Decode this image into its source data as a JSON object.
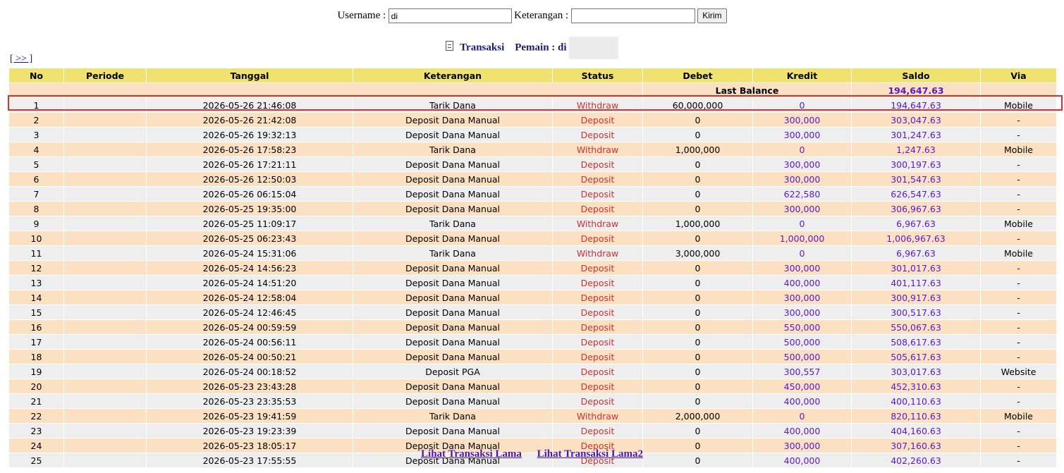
{
  "form": {
    "username_label": "Username :",
    "username_value": "di",
    "keterangan_label": "Keterangan :",
    "keterangan_value": "",
    "submit_label": "Kirim"
  },
  "title": {
    "transaksi": "Transaksi",
    "pemain_label": "Pemain : di"
  },
  "pager": {
    "next_label": "[ >> ]"
  },
  "table": {
    "headers": [
      "No",
      "Periode",
      "Tanggal",
      "Keterangan",
      "Status",
      "Debet",
      "Kredit",
      "Saldo",
      "Via"
    ],
    "last_balance_label": "Last Balance",
    "last_balance_value": "194,647.63",
    "rows": [
      [
        "1",
        "",
        "2026-05-26 21:46:08",
        "Tarik Dana",
        "Withdraw",
        "60,000,000",
        "0",
        "194,647.63",
        "Mobile"
      ],
      [
        "2",
        "",
        "2026-05-26 21:42:08",
        "Deposit Dana Manual",
        "Deposit",
        "0",
        "300,000",
        "303,047.63",
        "-"
      ],
      [
        "3",
        "",
        "2026-05-26 19:32:13",
        "Deposit Dana Manual",
        "Deposit",
        "0",
        "300,000",
        "301,247.63",
        "-"
      ],
      [
        "4",
        "",
        "2026-05-26 17:58:23",
        "Tarik Dana",
        "Withdraw",
        "1,000,000",
        "0",
        "1,247.63",
        "Mobile"
      ],
      [
        "5",
        "",
        "2026-05-26 17:21:11",
        "Deposit Dana Manual",
        "Deposit",
        "0",
        "300,000",
        "300,197.63",
        "-"
      ],
      [
        "6",
        "",
        "2026-05-26 12:50:03",
        "Deposit Dana Manual",
        "Deposit",
        "0",
        "300,000",
        "301,547.63",
        "-"
      ],
      [
        "7",
        "",
        "2026-05-26 06:15:04",
        "Deposit Dana Manual",
        "Deposit",
        "0",
        "622,580",
        "626,547.63",
        "-"
      ],
      [
        "8",
        "",
        "2026-05-25 19:35:00",
        "Deposit Dana Manual",
        "Deposit",
        "0",
        "300,000",
        "306,967.63",
        "-"
      ],
      [
        "9",
        "",
        "2026-05-25 11:09:17",
        "Tarik Dana",
        "Withdraw",
        "1,000,000",
        "0",
        "6,967.63",
        "Mobile"
      ],
      [
        "10",
        "",
        "2026-05-25 06:23:43",
        "Deposit Dana Manual",
        "Deposit",
        "0",
        "1,000,000",
        "1,006,967.63",
        "-"
      ],
      [
        "11",
        "",
        "2026-05-24 15:31:06",
        "Tarik Dana",
        "Withdraw",
        "3,000,000",
        "0",
        "6,967.63",
        "Mobile"
      ],
      [
        "12",
        "",
        "2026-05-24 14:56:23",
        "Deposit Dana Manual",
        "Deposit",
        "0",
        "300,000",
        "301,017.63",
        "-"
      ],
      [
        "13",
        "",
        "2026-05-24 14:51:20",
        "Deposit Dana Manual",
        "Deposit",
        "0",
        "400,000",
        "401,117.63",
        "-"
      ],
      [
        "14",
        "",
        "2026-05-24 12:58:04",
        "Deposit Dana Manual",
        "Deposit",
        "0",
        "300,000",
        "300,917.63",
        "-"
      ],
      [
        "15",
        "",
        "2026-05-24 12:46:45",
        "Deposit Dana Manual",
        "Deposit",
        "0",
        "300,000",
        "300,517.63",
        "-"
      ],
      [
        "16",
        "",
        "2026-05-24 00:59:59",
        "Deposit Dana Manual",
        "Deposit",
        "0",
        "550,000",
        "550,067.63",
        "-"
      ],
      [
        "17",
        "",
        "2026-05-24 00:56:11",
        "Deposit Dana Manual",
        "Deposit",
        "0",
        "500,000",
        "508,617.63",
        "-"
      ],
      [
        "18",
        "",
        "2026-05-24 00:50:21",
        "Deposit Dana Manual",
        "Deposit",
        "0",
        "500,000",
        "505,617.63",
        "-"
      ],
      [
        "19",
        "",
        "2026-05-24 00:18:52",
        "Deposit PGA",
        "Deposit",
        "0",
        "300,557",
        "303,017.63",
        "Website"
      ],
      [
        "20",
        "",
        "2026-05-23 23:43:28",
        "Deposit Dana Manual",
        "Deposit",
        "0",
        "450,000",
        "452,310.63",
        "-"
      ],
      [
        "21",
        "",
        "2026-05-23 23:35:53",
        "Deposit Dana Manual",
        "Deposit",
        "0",
        "400,000",
        "400,110.63",
        "-"
      ],
      [
        "22",
        "",
        "2026-05-23 19:41:59",
        "Tarik Dana",
        "Withdraw",
        "2,000,000",
        "0",
        "820,110.63",
        "Mobile"
      ],
      [
        "23",
        "",
        "2026-05-23 19:23:39",
        "Deposit Dana Manual",
        "Deposit",
        "0",
        "400,000",
        "404,160.63",
        "-"
      ],
      [
        "24",
        "",
        "2026-05-23 18:05:17",
        "Deposit Dana Manual",
        "Deposit",
        "0",
        "300,000",
        "307,160.63",
        "-"
      ],
      [
        "25",
        "",
        "2026-05-23 17:55:55",
        "Deposit Dana Manual",
        "Deposit",
        "0",
        "400,000",
        "402,260.63",
        "-"
      ]
    ]
  },
  "footer": {
    "link1": "Lihat Transaksi Lama",
    "link2": "Lihat Transaksi Lama2"
  },
  "colors": {
    "header_bg": "#f0e26e",
    "row_alt_bg": "#fbe0c2",
    "row_bg": "#eeeeee",
    "status_color": "#cc3333",
    "amount_color": "#5a18c8",
    "highlight_border": "#d9312c"
  }
}
